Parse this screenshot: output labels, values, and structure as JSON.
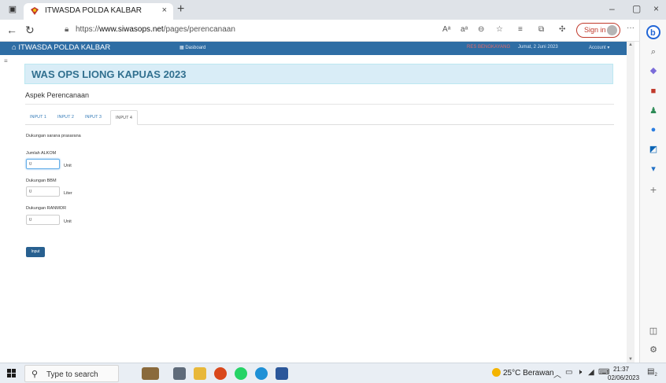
{
  "browser": {
    "tab_title": "ITWASDA POLDA KALBAR",
    "tab_close": "×",
    "new_tab": "+",
    "url_prefix": "https://",
    "url_host": "www.siwasops.net",
    "url_path": "/pages/perencanaan",
    "sign_in": "Sign in",
    "more": "···",
    "window": {
      "minimize": "–",
      "restore": "▢",
      "close": "×"
    },
    "icons": [
      "read-aloud-icon",
      "font-size-icon",
      "zoom-icon",
      "favorite-add-icon",
      "favorites-icon",
      "collections-icon",
      "extensions-icon",
      "bing-copilot-icon"
    ],
    "sidebar_icons": [
      "search-icon",
      "shopping-tag-icon",
      "tools-icon",
      "games-icon",
      "office-icon",
      "outlook-icon",
      "drop-icon",
      "add-icon",
      "split-screen-icon",
      "settings-icon"
    ]
  },
  "site_nav": {
    "brand": "ITWASDA POLDA KALBAR",
    "dashboard": "Dasboard",
    "user": "RES BENGKAYANG",
    "date": "Jumat, 2 Juni 2023",
    "account": "Account"
  },
  "page": {
    "header": "WAS OPS LIONG KAPUAS 2023",
    "section": "Aspek Perencanaan",
    "tabs": [
      {
        "label": "INPUT 1",
        "active": false
      },
      {
        "label": "INPUT 2",
        "active": false
      },
      {
        "label": "INPUT 3",
        "active": false
      },
      {
        "label": "INPUT 4",
        "active": true
      }
    ],
    "subheading": "Dukungan sarana prasarana",
    "fields": [
      {
        "label": "Jumlah ALKOM",
        "value": "0",
        "unit": "Unit"
      },
      {
        "label": "Dukungan BBM",
        "value": "0",
        "unit": "Liter"
      },
      {
        "label": "Dukungan RANMOR",
        "value": "0",
        "unit": "Unit"
      }
    ],
    "submit": "Input"
  },
  "taskbar": {
    "search_placeholder": "Type to search",
    "weather": "25°C Berawan",
    "time": "21:37",
    "date": "02/06/2023",
    "notification_count": "2"
  },
  "colors": {
    "nav_blue": "#2e6da4",
    "banner_bg": "#d9edf7",
    "banner_text": "#31708f",
    "button": "#286090",
    "user_red": "#e36b6b"
  }
}
